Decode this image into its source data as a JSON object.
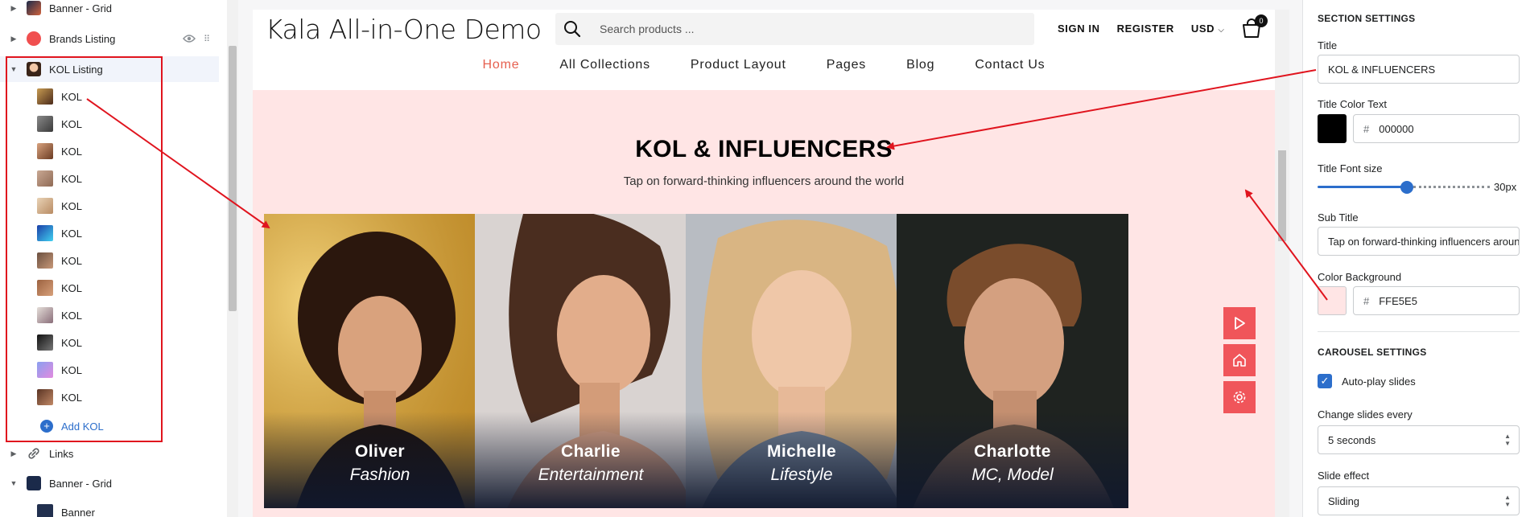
{
  "sidebar": {
    "top_item": {
      "label": "Banner - Grid"
    },
    "brands": {
      "label": "Brands Listing",
      "eye_icon": "eye-icon",
      "drag_icon": "drag-handle-icon"
    },
    "kol_listing": {
      "label": "KOL Listing"
    },
    "kol_children": [
      {
        "label": "KOL"
      },
      {
        "label": "KOL"
      },
      {
        "label": "KOL"
      },
      {
        "label": "KOL"
      },
      {
        "label": "KOL"
      },
      {
        "label": "KOL"
      },
      {
        "label": "KOL"
      },
      {
        "label": "KOL"
      },
      {
        "label": "KOL"
      },
      {
        "label": "KOL"
      },
      {
        "label": "KOL"
      },
      {
        "label": "KOL"
      }
    ],
    "add_kol": "Add KOL",
    "links": {
      "label": "Links"
    },
    "banner_grid_2": {
      "label": "Banner - Grid"
    },
    "banner_child": {
      "label": "Banner"
    }
  },
  "store": {
    "title": "Kala All-in-One Demo",
    "search_placeholder": "Search products ...",
    "sign_in": "SIGN IN",
    "register": "REGISTER",
    "currency": "USD",
    "cart_count": "0",
    "nav": [
      {
        "label": "Home",
        "current": true
      },
      {
        "label": "All Collections"
      },
      {
        "label": "Product Layout"
      },
      {
        "label": "Pages"
      },
      {
        "label": "Blog"
      },
      {
        "label": "Contact Us"
      }
    ]
  },
  "kol_section": {
    "title": "KOL & INFLUENCERS",
    "subtitle": "Tap on forward-thinking influencers around the world",
    "background": "#FFE5E5",
    "title_color": "#000000",
    "cards": [
      {
        "name": "Oliver",
        "role": "Fashion"
      },
      {
        "name": "Charlie",
        "role": "Entertainment"
      },
      {
        "name": "Michelle",
        "role": "Lifestyle"
      },
      {
        "name": "Charlotte",
        "role": "MC, Model"
      }
    ],
    "float_buttons": [
      "play-icon",
      "home-icon",
      "gear-icon"
    ]
  },
  "settings": {
    "section_heading": "SECTION SETTINGS",
    "title_label": "Title",
    "title_value": "KOL & INFLUENCERS",
    "title_color_label": "Title Color Text",
    "title_color_hex": "000000",
    "font_size_label": "Title Font size",
    "font_size_value": "30px",
    "font_size_fraction": 0.52,
    "subtitle_label": "Sub Title",
    "subtitle_value": "Tap on forward-thinking influencers around the world",
    "bg_label": "Color Background",
    "bg_hex": "FFE5E5",
    "carousel_heading": "CAROUSEL SETTINGS",
    "autoplay_label": "Auto-play slides",
    "autoplay_checked": true,
    "change_every_label": "Change slides every",
    "change_every_value": "5 seconds",
    "effect_label": "Slide effect",
    "effect_value": "Sliding"
  },
  "colors": {
    "accent": "#2c6ecb",
    "nav_current": "#e6604f",
    "annotation_red": "#e0141e",
    "float_button": "#f0555a"
  }
}
